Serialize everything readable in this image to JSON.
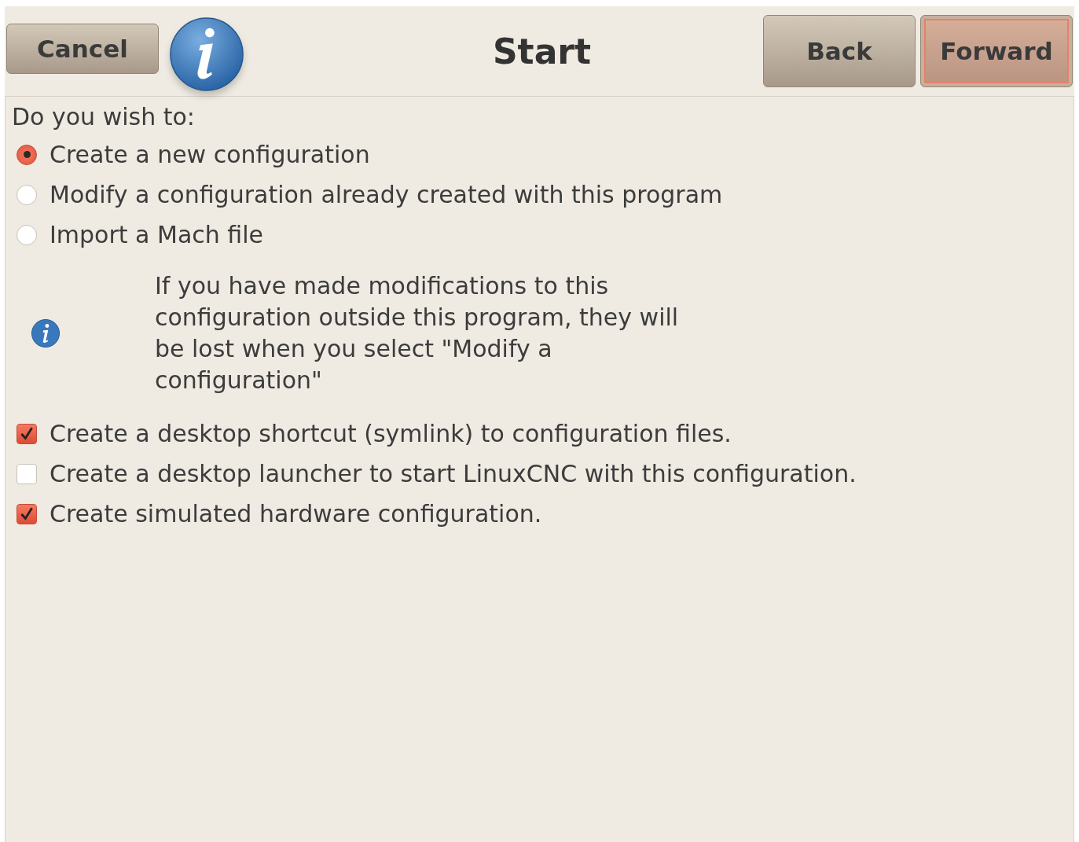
{
  "header": {
    "buttons": [
      {
        "label": "Cancel",
        "kind": "cancel",
        "focused": false
      },
      {
        "label": "Back",
        "kind": "back",
        "focused": false
      },
      {
        "label": "Forward",
        "kind": "forward",
        "focused": true
      }
    ],
    "title": "Start"
  },
  "prompt": "Do you wish to:",
  "options": [
    {
      "label": "Create a new configuration",
      "selected": true
    },
    {
      "label": "Modify a configuration already created with this program",
      "selected": false
    },
    {
      "label": "Import a Mach file",
      "selected": false
    }
  ],
  "notice": "If you have made modifications to this configuration outside this program, they will be lost when you select \"Modify a configuration\"",
  "checks": [
    {
      "label": "Create a desktop shortcut (symlink) to configuration files.",
      "checked": true
    },
    {
      "label": "Create a desktop launcher to start LinuxCNC with this configuration.",
      "checked": false
    },
    {
      "label": "Create simulated hardware configuration.",
      "checked": true
    }
  ]
}
